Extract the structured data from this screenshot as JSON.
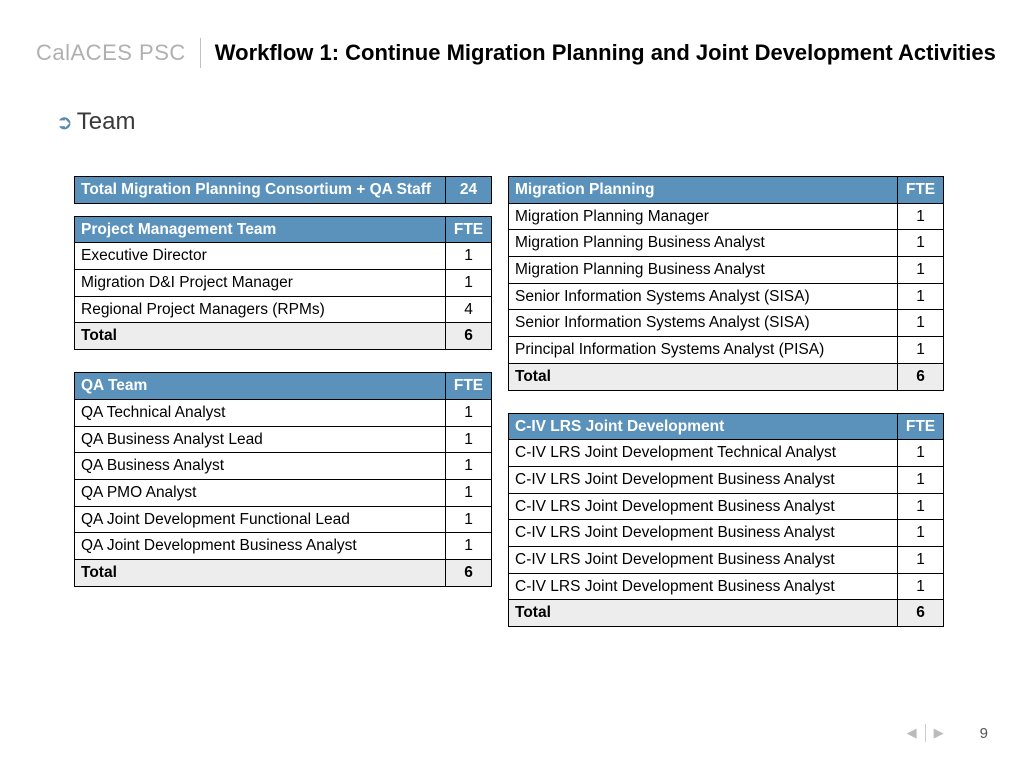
{
  "brand": "CalACES PSC",
  "title": "Workflow 1: Continue Migration Planning and Joint Development Activities",
  "section_heading": "Team",
  "summary": {
    "label": "Total Migration Planning Consortium + QA Staff",
    "value": "24"
  },
  "fte_label": "FTE",
  "total_label": "Total",
  "tables": {
    "pmt": {
      "title": "Project Management Team",
      "rows": [
        {
          "role": "Executive Director",
          "fte": "1"
        },
        {
          "role": "Migration D&I Project Manager",
          "fte": "1"
        },
        {
          "role": "Regional Project Managers (RPMs)",
          "fte": "4"
        }
      ],
      "total": "6"
    },
    "qa": {
      "title": "QA Team",
      "rows": [
        {
          "role": "QA Technical Analyst",
          "fte": "1"
        },
        {
          "role": "QA Business Analyst Lead",
          "fte": "1"
        },
        {
          "role": "QA Business Analyst",
          "fte": "1"
        },
        {
          "role": "QA PMO Analyst",
          "fte": "1"
        },
        {
          "role": "QA Joint Development Functional Lead",
          "fte": "1"
        },
        {
          "role": "QA Joint Development Business Analyst",
          "fte": "1"
        }
      ],
      "total": "6"
    },
    "migration": {
      "title": "Migration Planning",
      "rows": [
        {
          "role": "Migration Planning Manager",
          "fte": "1"
        },
        {
          "role": "Migration Planning Business Analyst",
          "fte": "1"
        },
        {
          "role": "Migration Planning Business Analyst",
          "fte": "1"
        },
        {
          "role": "Senior Information Systems Analyst (SISA)",
          "fte": "1"
        },
        {
          "role": "Senior Information Systems Analyst (SISA)",
          "fte": "1"
        },
        {
          "role": "Principal Information Systems Analyst (PISA)",
          "fte": "1"
        }
      ],
      "total": "6"
    },
    "civ": {
      "title": "C-IV LRS Joint Development",
      "rows": [
        {
          "role": "C-IV LRS Joint Development Technical Analyst",
          "fte": "1"
        },
        {
          "role": "C-IV LRS Joint Development Business Analyst",
          "fte": "1"
        },
        {
          "role": "C-IV LRS Joint Development Business Analyst",
          "fte": "1"
        },
        {
          "role": "C-IV LRS Joint Development Business Analyst",
          "fte": "1"
        },
        {
          "role": "C-IV LRS Joint Development Business Analyst",
          "fte": "1"
        },
        {
          "role": "C-IV LRS Joint Development Business Analyst",
          "fte": "1"
        }
      ],
      "total": "6"
    }
  },
  "page_number": "9"
}
